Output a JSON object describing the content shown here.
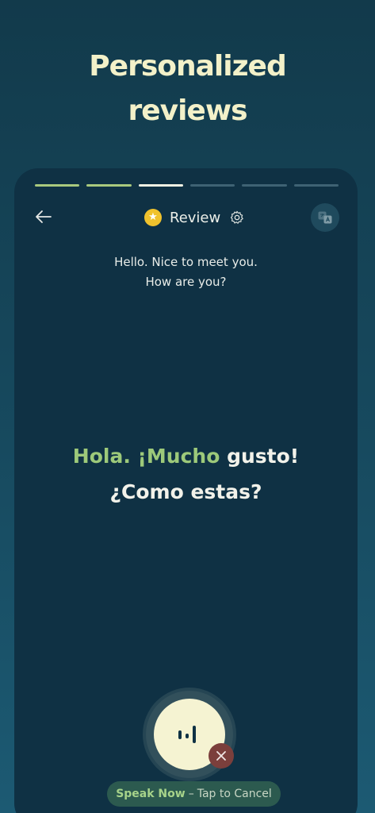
{
  "headline": {
    "line1": "Personalized",
    "line2": "reviews"
  },
  "progress": {
    "total_segments": 6,
    "completed": 2,
    "current": 3
  },
  "nav": {
    "back_icon": "arrow-left-icon",
    "star_icon": "star-icon",
    "title": "Review",
    "settings_icon": "gear-icon",
    "translate_icon": "translate-icon"
  },
  "prompt": {
    "line1": "Hello. Nice to meet you.",
    "line2": "How are you?"
  },
  "answer": {
    "line1_highlight": "Hola. ¡Mucho",
    "line1_rest": "gusto!",
    "line2": "¿Como estas?"
  },
  "controls": {
    "mic_icon": "audio-wave-icon",
    "cancel_icon": "close-icon",
    "speak_label": "Speak Now",
    "separator": "–",
    "cancel_hint": "Tap to Cancel"
  },
  "colors": {
    "background": "#123a4b",
    "card": "#0f3144",
    "accent_green": "#9dc97a",
    "headline": "#f3f1c9",
    "star": "#f0c22d",
    "cancel": "#7b3f3c"
  }
}
